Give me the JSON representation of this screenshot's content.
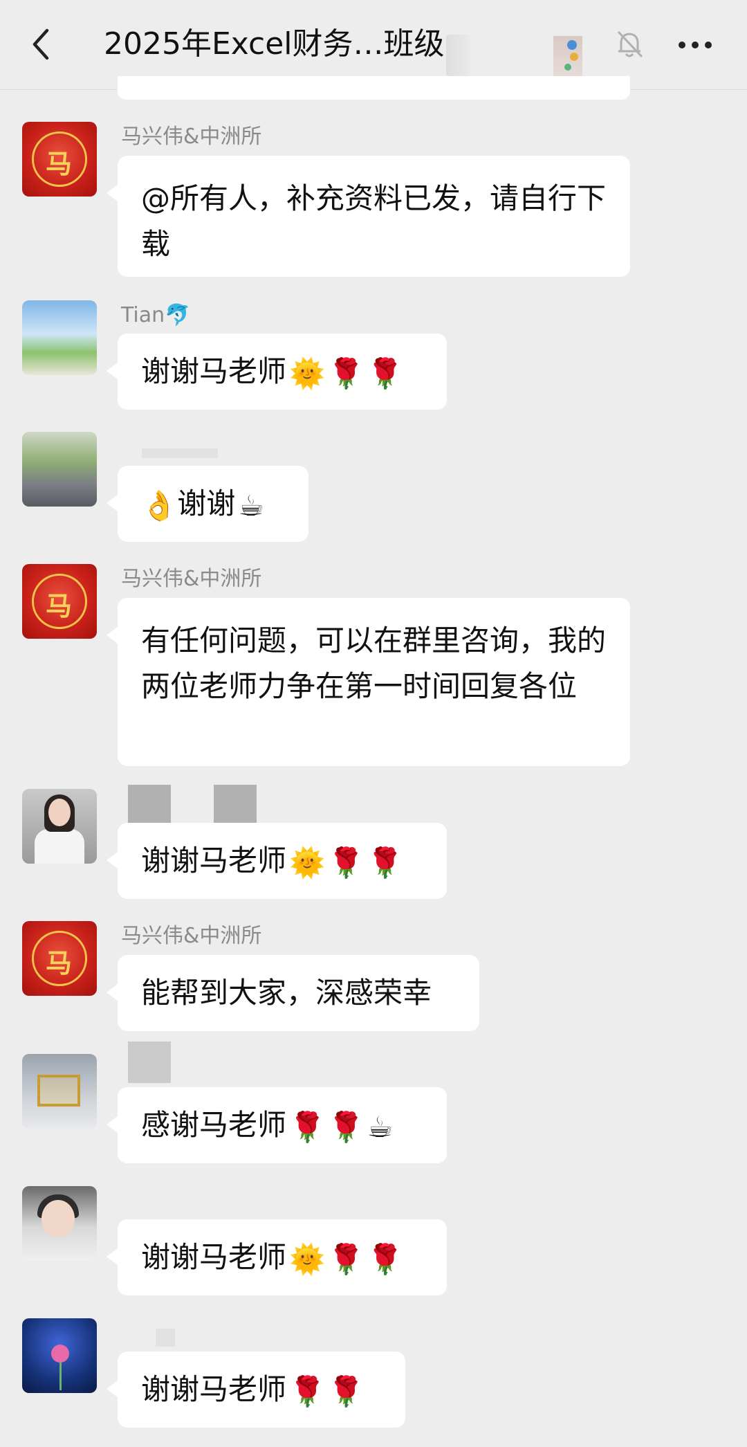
{
  "header": {
    "title": "2025年Excel财务…班级",
    "back_icon": "chevron-left-icon",
    "mute_icon": "bell-off-icon",
    "more_icon": "more-horizontal-icon"
  },
  "messages": [
    {
      "sender": "马兴伟&中洲所",
      "text": "@所有人，补充资料已发，请自行下载"
    },
    {
      "sender": "Tian",
      "sender_emoji": "🐬",
      "text": "谢谢马老师",
      "emojis": [
        "🌞",
        "🌹",
        "🌹"
      ]
    },
    {
      "sender": "",
      "text": "谢谢",
      "lead_emoji": "👌",
      "emojis": [
        "☕"
      ]
    },
    {
      "sender": "马兴伟&中洲所",
      "text": "有任何问题，可以在群里咨询，我的两位老师力争在第一时间回复各位"
    },
    {
      "sender": "",
      "text": "谢谢马老师",
      "emojis": [
        "🌞",
        "🌹",
        "🌹"
      ]
    },
    {
      "sender": "马兴伟&中洲所",
      "text": "能帮到大家，深感荣幸"
    },
    {
      "sender": "",
      "text": "感谢马老师",
      "emojis": [
        "🌹",
        "🌹",
        "☕"
      ]
    },
    {
      "sender": "",
      "text": "谢谢马老师",
      "emojis": [
        "🌞",
        "🌹",
        "🌹"
      ]
    },
    {
      "sender": "",
      "text": "谢谢马老师",
      "emojis": [
        "🌹",
        "🌹"
      ]
    }
  ],
  "avatar_glyph": "马"
}
